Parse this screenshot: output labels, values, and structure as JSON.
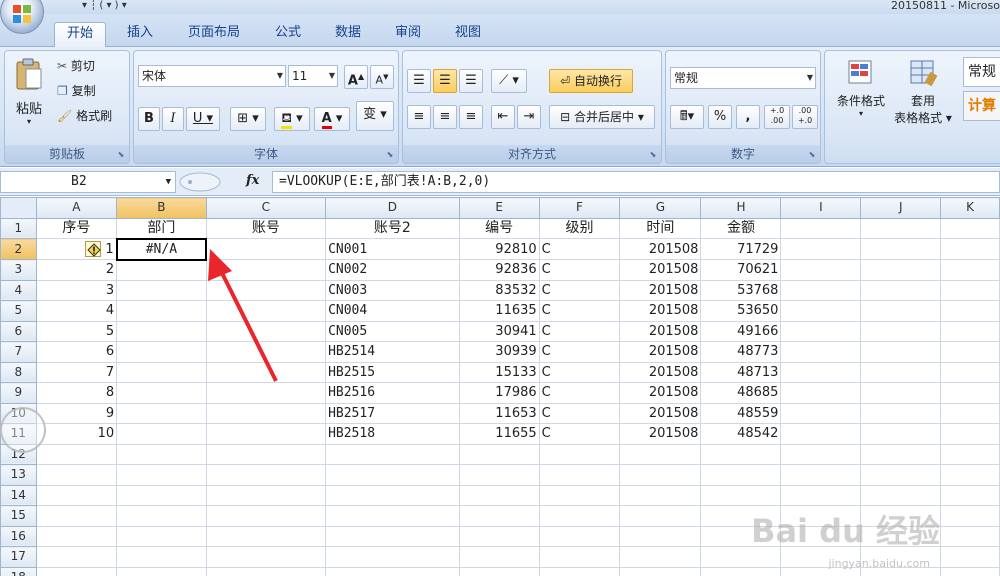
{
  "window": {
    "title": "20150811 - Microso",
    "qat": "▾ ┆ ( ▾ ) ▾"
  },
  "tabs": [
    {
      "label": "开始",
      "active": true
    },
    {
      "label": "插入"
    },
    {
      "label": "页面布局"
    },
    {
      "label": "公式"
    },
    {
      "label": "数据"
    },
    {
      "label": "审阅"
    },
    {
      "label": "视图"
    }
  ],
  "clipboard": {
    "label": "剪贴板",
    "paste": "粘贴",
    "cut": "剪切",
    "copy": "复制",
    "format_painter": "格式刷"
  },
  "font": {
    "label": "字体",
    "name": "宋体",
    "size": "11",
    "bold": "B",
    "italic": "I",
    "underline": "U",
    "font_color_glyph": "A",
    "pinyin_glyph": "变"
  },
  "alignment": {
    "label": "对齐方式",
    "wrap_text": "自动换行",
    "merge_center": "合并后居中"
  },
  "number": {
    "label": "数字",
    "format": "常规",
    "percent": "%",
    "comma": ",",
    "inc_decimal": "+.0 .00",
    "dec_decimal": ".00 +.0"
  },
  "styles": {
    "conditional_format": "条件格式",
    "format_as_table_1": "套用",
    "format_as_table_2": "表格格式",
    "style_normal": "常规",
    "style_calc": "计算"
  },
  "formula_bar": {
    "name_box": "B2",
    "fx": "fx",
    "formula": "=VLOOKUP(E:E,部门表!A:B,2,0)"
  },
  "sheet": {
    "columns": [
      "A",
      "B",
      "C",
      "D",
      "E",
      "F",
      "G",
      "H",
      "I",
      "J",
      "K"
    ],
    "selected_column": "B",
    "selected_row": "2",
    "headers": [
      "序号",
      "部门",
      "账号",
      "账号2",
      "编号",
      "级别",
      "时间",
      "金额"
    ],
    "rows": [
      {
        "n": "2",
        "a": "1",
        "b": "#N/A",
        "d": "CN001",
        "e": "92810",
        "f": "C",
        "g": "201508",
        "h": "71729"
      },
      {
        "n": "3",
        "a": "2",
        "b": "",
        "d": "CN002",
        "e": "92836",
        "f": "C",
        "g": "201508",
        "h": "70621"
      },
      {
        "n": "4",
        "a": "3",
        "b": "",
        "d": "CN003",
        "e": "83532",
        "f": "C",
        "g": "201508",
        "h": "53768"
      },
      {
        "n": "5",
        "a": "4",
        "b": "",
        "d": "CN004",
        "e": "11635",
        "f": "C",
        "g": "201508",
        "h": "53650"
      },
      {
        "n": "6",
        "a": "5",
        "b": "",
        "d": "CN005",
        "e": "30941",
        "f": "C",
        "g": "201508",
        "h": "49166"
      },
      {
        "n": "7",
        "a": "6",
        "b": "",
        "d": "HB2514",
        "e": "30939",
        "f": "C",
        "g": "201508",
        "h": "48773"
      },
      {
        "n": "8",
        "a": "7",
        "b": "",
        "d": "HB2515",
        "e": "15133",
        "f": "C",
        "g": "201508",
        "h": "48713"
      },
      {
        "n": "9",
        "a": "8",
        "b": "",
        "d": "HB2516",
        "e": "17986",
        "f": "C",
        "g": "201508",
        "h": "48685"
      },
      {
        "n": "10",
        "a": "9",
        "b": "",
        "d": "HB2517",
        "e": "11653",
        "f": "C",
        "g": "201508",
        "h": "48559"
      },
      {
        "n": "11",
        "a": "10",
        "b": "",
        "d": "HB2518",
        "e": "11655",
        "f": "C",
        "g": "201508",
        "h": "48542"
      }
    ],
    "empty_rows": [
      "12",
      "13",
      "14",
      "15",
      "16",
      "17",
      "18"
    ]
  },
  "watermark": {
    "brand": "Bai du 经验",
    "url": "jingyan.baidu.com"
  },
  "colors": {
    "ribbon_text": "#15428b",
    "selection_header": "#f1c15f",
    "arrow": "#e8262b"
  }
}
